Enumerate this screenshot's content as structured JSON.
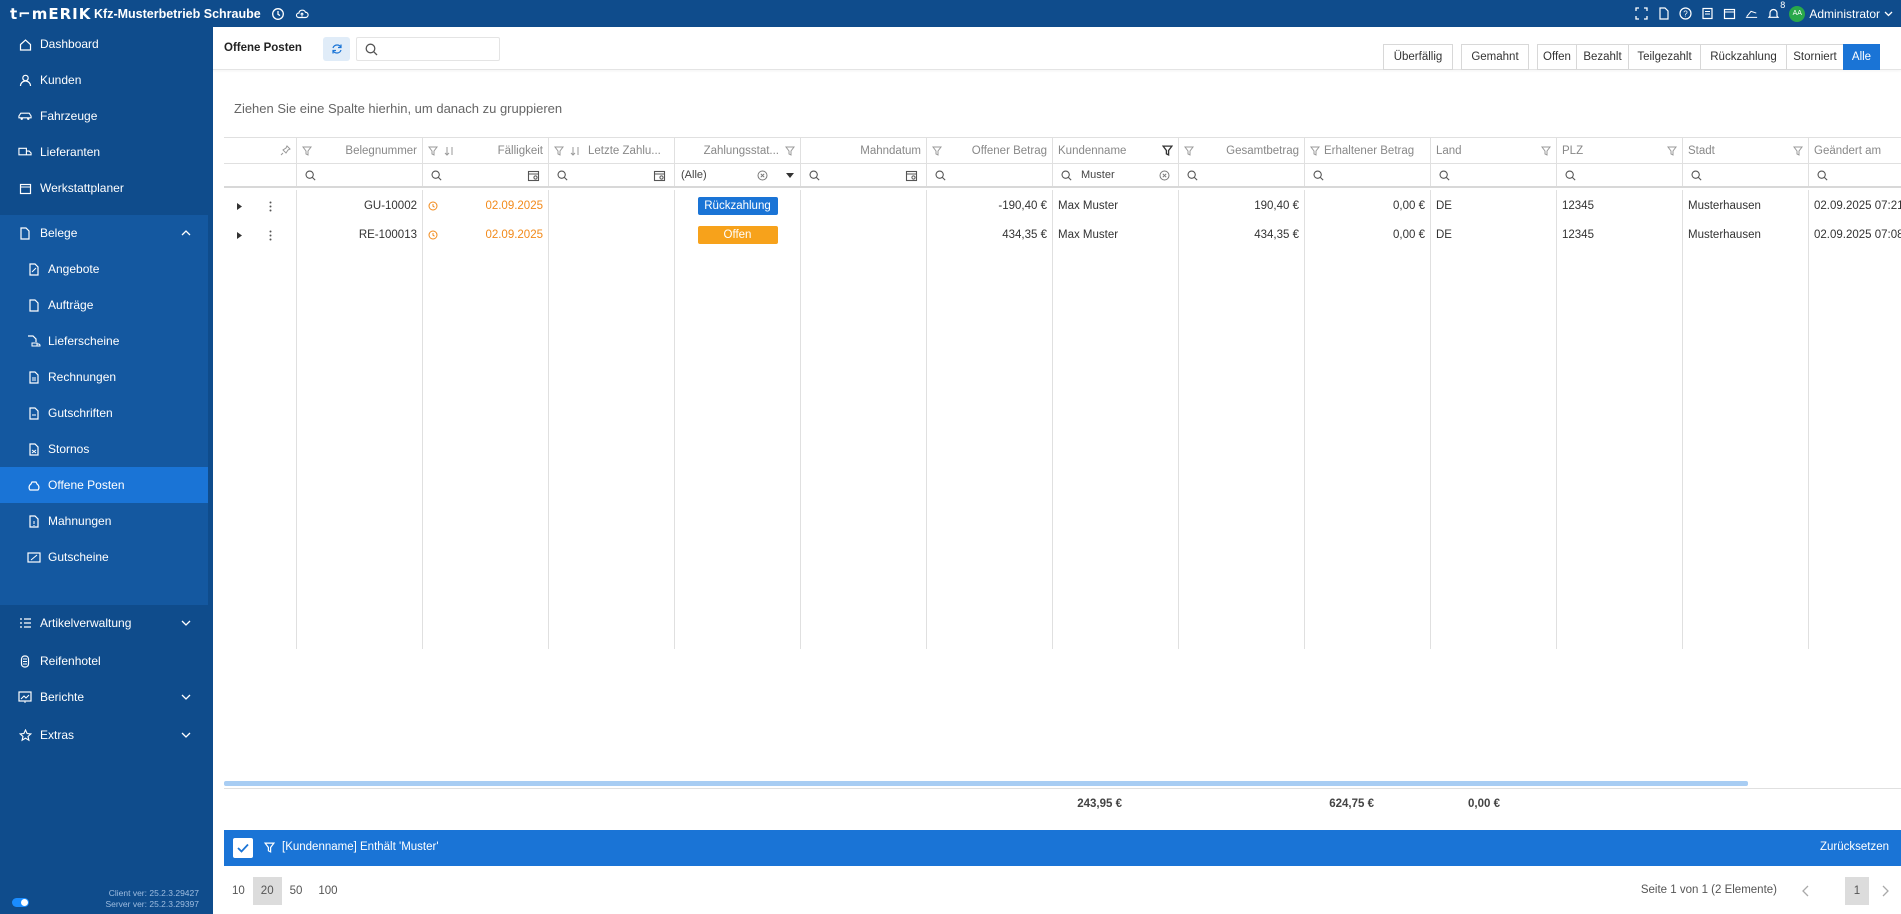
{
  "app": {
    "logo": "t⌐mERIK",
    "company": "Kfz-Musterbetrieb Schraube",
    "user": "Administrator",
    "avatar_initials": "AA",
    "notification_count": "8"
  },
  "sidebar": {
    "items": [
      {
        "label": "Dashboard",
        "icon": "home-icon"
      },
      {
        "label": "Kunden",
        "icon": "user-icon"
      },
      {
        "label": "Fahrzeuge",
        "icon": "car-icon"
      },
      {
        "label": "Lieferanten",
        "icon": "truck-icon"
      },
      {
        "label": "Werkstattplaner",
        "icon": "calendar-icon"
      },
      {
        "label": "Belege",
        "icon": "document-icon"
      }
    ],
    "belege_sub": [
      {
        "label": "Angebote",
        "icon": "document-edit-icon"
      },
      {
        "label": "Aufträge",
        "icon": "document-icon"
      },
      {
        "label": "Lieferscheine",
        "icon": "document-truck-icon"
      },
      {
        "label": "Rechnungen",
        "icon": "document-invoice-icon"
      },
      {
        "label": "Gutschriften",
        "icon": "document-credit-icon"
      },
      {
        "label": "Stornos",
        "icon": "document-cancel-icon"
      },
      {
        "label": "Offene Posten",
        "icon": "money-bag-icon"
      },
      {
        "label": "Mahnungen",
        "icon": "document-warning-icon"
      },
      {
        "label": "Gutscheine",
        "icon": "voucher-icon"
      }
    ],
    "bottom_items": [
      {
        "label": "Artikelverwaltung",
        "icon": "list-icon"
      },
      {
        "label": "Reifenhotel",
        "icon": "tire-icon"
      },
      {
        "label": "Berichte",
        "icon": "chart-icon"
      },
      {
        "label": "Extras",
        "icon": "star-icon"
      }
    ],
    "client_version": "Client ver: 25.2.3.29427",
    "server_version": "Server ver: 25.2.3.29397"
  },
  "toolbar": {
    "title": "Offene Posten",
    "search_placeholder": "",
    "filters_left": [
      "Überfällig",
      "Gemahnt"
    ],
    "filters_right": [
      "Offen",
      "Bezahlt",
      "Teilgezahlt",
      "Rückzahlung",
      "Storniert",
      "Alle"
    ],
    "active_filter": "Alle"
  },
  "group_panel": "Ziehen Sie eine Spalte hierhin, um danach zu gruppieren",
  "grid": {
    "columns": [
      "",
      "Belegnummer",
      "Fälligkeit",
      "Letzte Zahlu...",
      "Zahlungsstat...",
      "Mahndatum",
      "Offener Betrag",
      "Kundenname",
      "Gesamtbetrag",
      "Erhaltener Betrag",
      "Land",
      "PLZ",
      "Stadt",
      "Geändert am"
    ],
    "filter_row": {
      "status": "(Alle)",
      "kundenname": "Muster"
    },
    "rows": [
      {
        "belegnummer": "GU-10002",
        "faelligkeit": "02.09.2025",
        "status": "Rückzahlung",
        "offener_betrag": "-190,40 €",
        "kundenname": "Max Muster",
        "gesamtbetrag": "190,40 €",
        "erhaltener_betrag": "0,00 €",
        "land": "DE",
        "plz": "12345",
        "stadt": "Musterhausen",
        "geaendert": "02.09.2025 07:21"
      },
      {
        "belegnummer": "RE-100013",
        "faelligkeit": "02.09.2025",
        "status": "Offen",
        "offener_betrag": "434,35 €",
        "kundenname": "Max Muster",
        "gesamtbetrag": "434,35 €",
        "erhaltener_betrag": "0,00 €",
        "land": "DE",
        "plz": "12345",
        "stadt": "Musterhausen",
        "geaendert": "02.09.2025 07:08"
      }
    ],
    "totals": {
      "offener_betrag": "243,95 €",
      "gesamtbetrag": "624,75 €",
      "erhaltener_betrag": "0,00 €"
    }
  },
  "filter_bar": {
    "text": "[Kundenname] Enthält 'Muster'",
    "reset": "Zurücksetzen"
  },
  "pager": {
    "sizes": [
      "10",
      "20",
      "50",
      "100"
    ],
    "selected_size": "20",
    "info": "Seite 1 von 1 (2 Elemente)",
    "current_page": "1"
  },
  "colors": {
    "sidebar": "#0f4c8c",
    "accent": "#1a74d6",
    "orange": "#f7a21b"
  }
}
